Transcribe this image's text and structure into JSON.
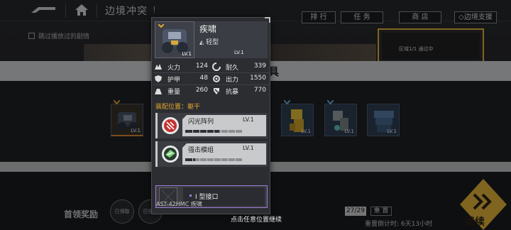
{
  "header": {
    "title": "边境冲突",
    "tabs": [
      "排 行",
      "任 务",
      "商 店",
      "◇边境支援"
    ]
  },
  "skip_option": {
    "label": "跳过播放过的剧情"
  },
  "event_card": {
    "text": "区域1/1 通过中"
  },
  "band_title": "具",
  "mech_slots": [
    {
      "level": "LV.1",
      "selected": true
    },
    {
      "level": "LV.1"
    },
    {
      "level": "LV.1"
    },
    {
      "level": "LV.1"
    }
  ],
  "bottom": {
    "first_reward_label": "首领奖励",
    "reward_circles": [
      "已领取",
      "已领取"
    ],
    "count": "27/29",
    "reset_label": "重 置",
    "reset_time": "重置倒计时: 6天13小时",
    "continue_label": "继续"
  },
  "unit_popup": {
    "name": "疾啸",
    "type": "轻型",
    "level": "LV.1",
    "stats": [
      {
        "label": "火力",
        "value": "124",
        "icon": "firepower-icon"
      },
      {
        "label": "耐久",
        "value": "339",
        "icon": "durability-icon"
      },
      {
        "label": "护甲",
        "value": "48",
        "icon": "armor-icon"
      },
      {
        "label": "出力",
        "value": "1550",
        "icon": "output-icon"
      },
      {
        "label": "重量",
        "value": "260",
        "icon": "weight-icon"
      },
      {
        "label": "抗暴",
        "value": "770",
        "icon": "crit-resist-icon"
      }
    ],
    "mount_position": "装配位置：躯干",
    "parts": [
      {
        "name": "闪光阵列",
        "level": "LV.1",
        "progress": 0.6
      },
      {
        "name": "强击模组",
        "level": "LV.1",
        "progress": 0.18
      }
    ],
    "empty_slot": "I 型接口",
    "footer": "AST-42HMC 疾啸"
  },
  "hint": "点击任意位置继续",
  "colors": {
    "accent": "#e5a830",
    "slot_purple": "#a07cd8",
    "continue": "#e8b83a"
  }
}
